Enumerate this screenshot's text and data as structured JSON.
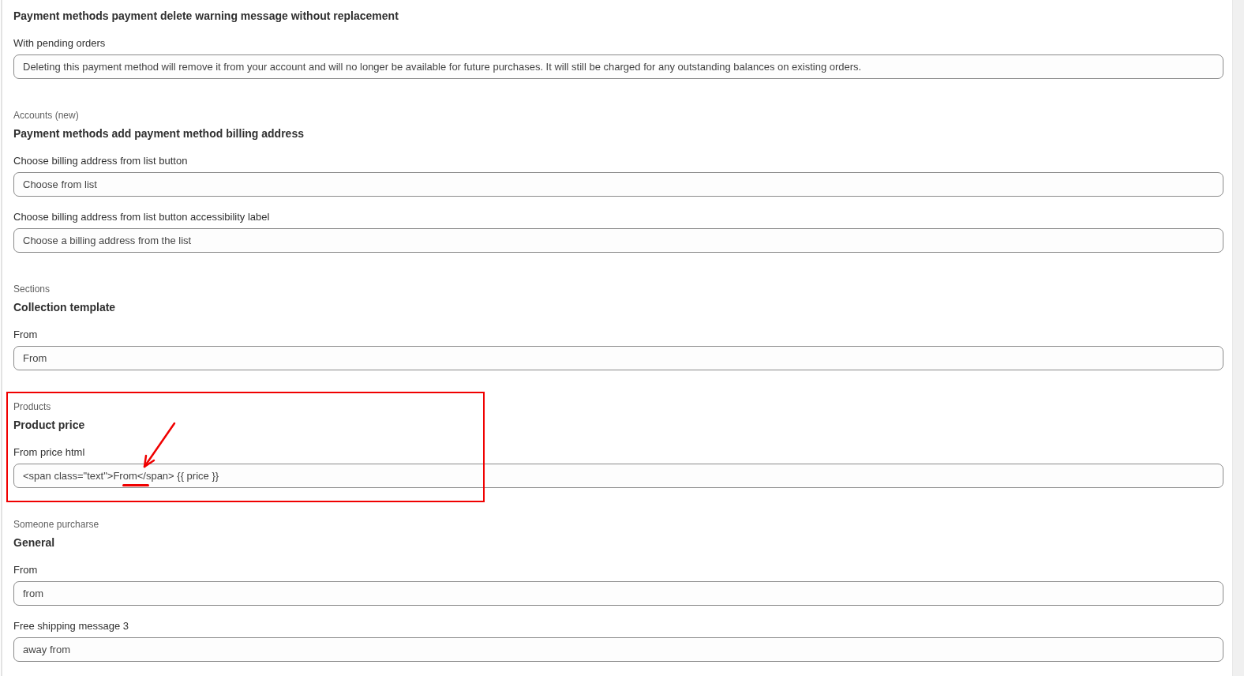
{
  "sections": [
    {
      "title": "Payment methods payment delete warning message without replacement",
      "highlighted": false,
      "fields": [
        {
          "label": "With pending orders",
          "value": "Deleting this payment method will remove it from your account and will no longer be available for future purchases. It will still be charged for any outstanding balances on existing orders."
        }
      ]
    },
    {
      "category": "Accounts (new)",
      "title": "Payment methods add payment method billing address",
      "highlighted": false,
      "fields": [
        {
          "label": "Choose billing address from list button",
          "value": "Choose from list"
        },
        {
          "label": "Choose billing address from list button accessibility label",
          "value": "Choose a billing address from the list"
        }
      ]
    },
    {
      "category": "Sections",
      "title": "Collection template",
      "highlighted": false,
      "fields": [
        {
          "label": "From",
          "value": "From"
        }
      ]
    },
    {
      "category": "Products",
      "title": "Product price",
      "highlighted": true,
      "fields": [
        {
          "label": "From price html",
          "value": "<span class=\"text\">From</span> {{ price }}"
        }
      ]
    },
    {
      "category": "Someone purcharse",
      "title": "General",
      "highlighted": false,
      "fields": [
        {
          "label": "From",
          "value": "from"
        },
        {
          "label": "Free shipping message 3",
          "value": "away from"
        }
      ]
    }
  ]
}
